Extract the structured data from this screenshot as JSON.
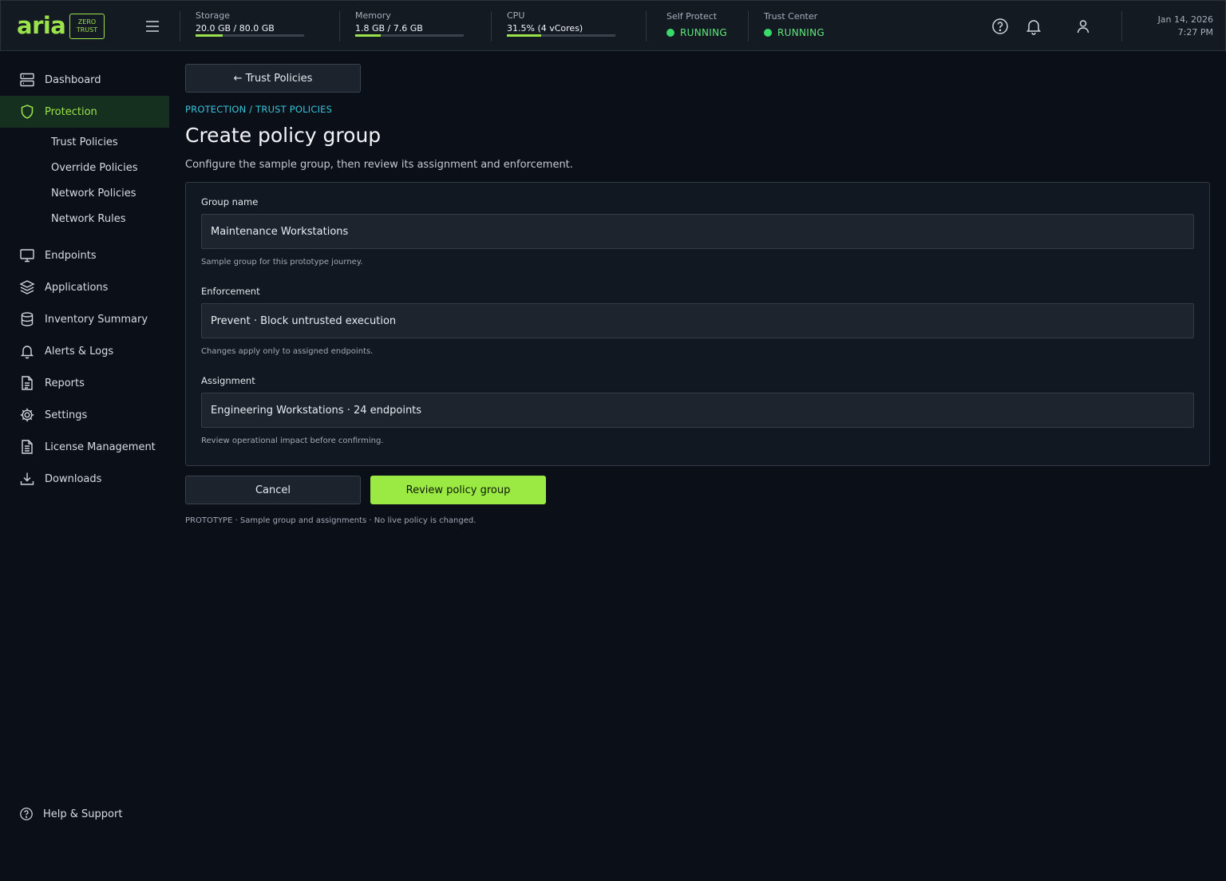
{
  "app": {
    "logo": "aria",
    "badge_line1": "ZERO",
    "badge_line2": "TRUST"
  },
  "topbar": {
    "storage": {
      "label": "Storage",
      "value": "20.0 GB / 80.0 GB",
      "fraction": 0.25
    },
    "memory": {
      "label": "Memory",
      "value": "1.8 GB / 7.6 GB",
      "fraction": 0.237
    },
    "cpu": {
      "label": "CPU",
      "value": "31.5% (4 vCores)",
      "fraction": 0.315
    },
    "self_protect": {
      "label": "Self Protect",
      "value": "RUNNING"
    },
    "trust_center": {
      "label": "Trust Center",
      "value": "RUNNING"
    },
    "date": "Jan 14, 2026",
    "time": "7:27 PM",
    "icons": [
      "help-icon",
      "bell-icon",
      "user-icon"
    ]
  },
  "sidebar": {
    "items": [
      {
        "label": "Dashboard",
        "icon": "server-icon"
      },
      {
        "label": "Protection",
        "icon": "shield-icon",
        "active": true
      },
      {
        "label": "Endpoints",
        "icon": "monitor-icon"
      },
      {
        "label": "Applications",
        "icon": "layers-icon"
      },
      {
        "label": "Inventory Summary",
        "icon": "database-icon"
      },
      {
        "label": "Alerts & Logs",
        "icon": "bell-icon"
      },
      {
        "label": "Reports",
        "icon": "document-icon"
      },
      {
        "label": "Settings",
        "icon": "gear-icon"
      },
      {
        "label": "License Management",
        "icon": "license-icon"
      },
      {
        "label": "Downloads",
        "icon": "download-icon"
      }
    ],
    "sub_items": [
      "Trust Policies",
      "Override Policies",
      "Network Policies",
      "Network Rules"
    ],
    "help": "Help & Support"
  },
  "main": {
    "back_label": "← Trust Policies",
    "breadcrumb": "PROTECTION / TRUST POLICIES",
    "title": "Create policy group",
    "subtitle": "Configure the sample group, then review its assignment and enforcement.",
    "fields": [
      {
        "label": "Group name",
        "value": "Maintenance Workstations",
        "hint": "Sample group for this prototype journey."
      },
      {
        "label": "Enforcement",
        "value": "Prevent · Block untrusted execution",
        "hint": "Changes apply only to assigned endpoints."
      },
      {
        "label": "Assignment",
        "value": "Engineering Workstations · 24 endpoints",
        "hint": "Review operational impact before confirming."
      }
    ],
    "cancel_label": "Cancel",
    "review_label": "Review policy group",
    "footnote": "PROTOTYPE · Sample group and assignments · No live policy is changed."
  },
  "colors": {
    "accent": "#9be34a",
    "running": "#39d96a",
    "breadcrumb": "#35c4d9",
    "background": "#0b0f17"
  }
}
